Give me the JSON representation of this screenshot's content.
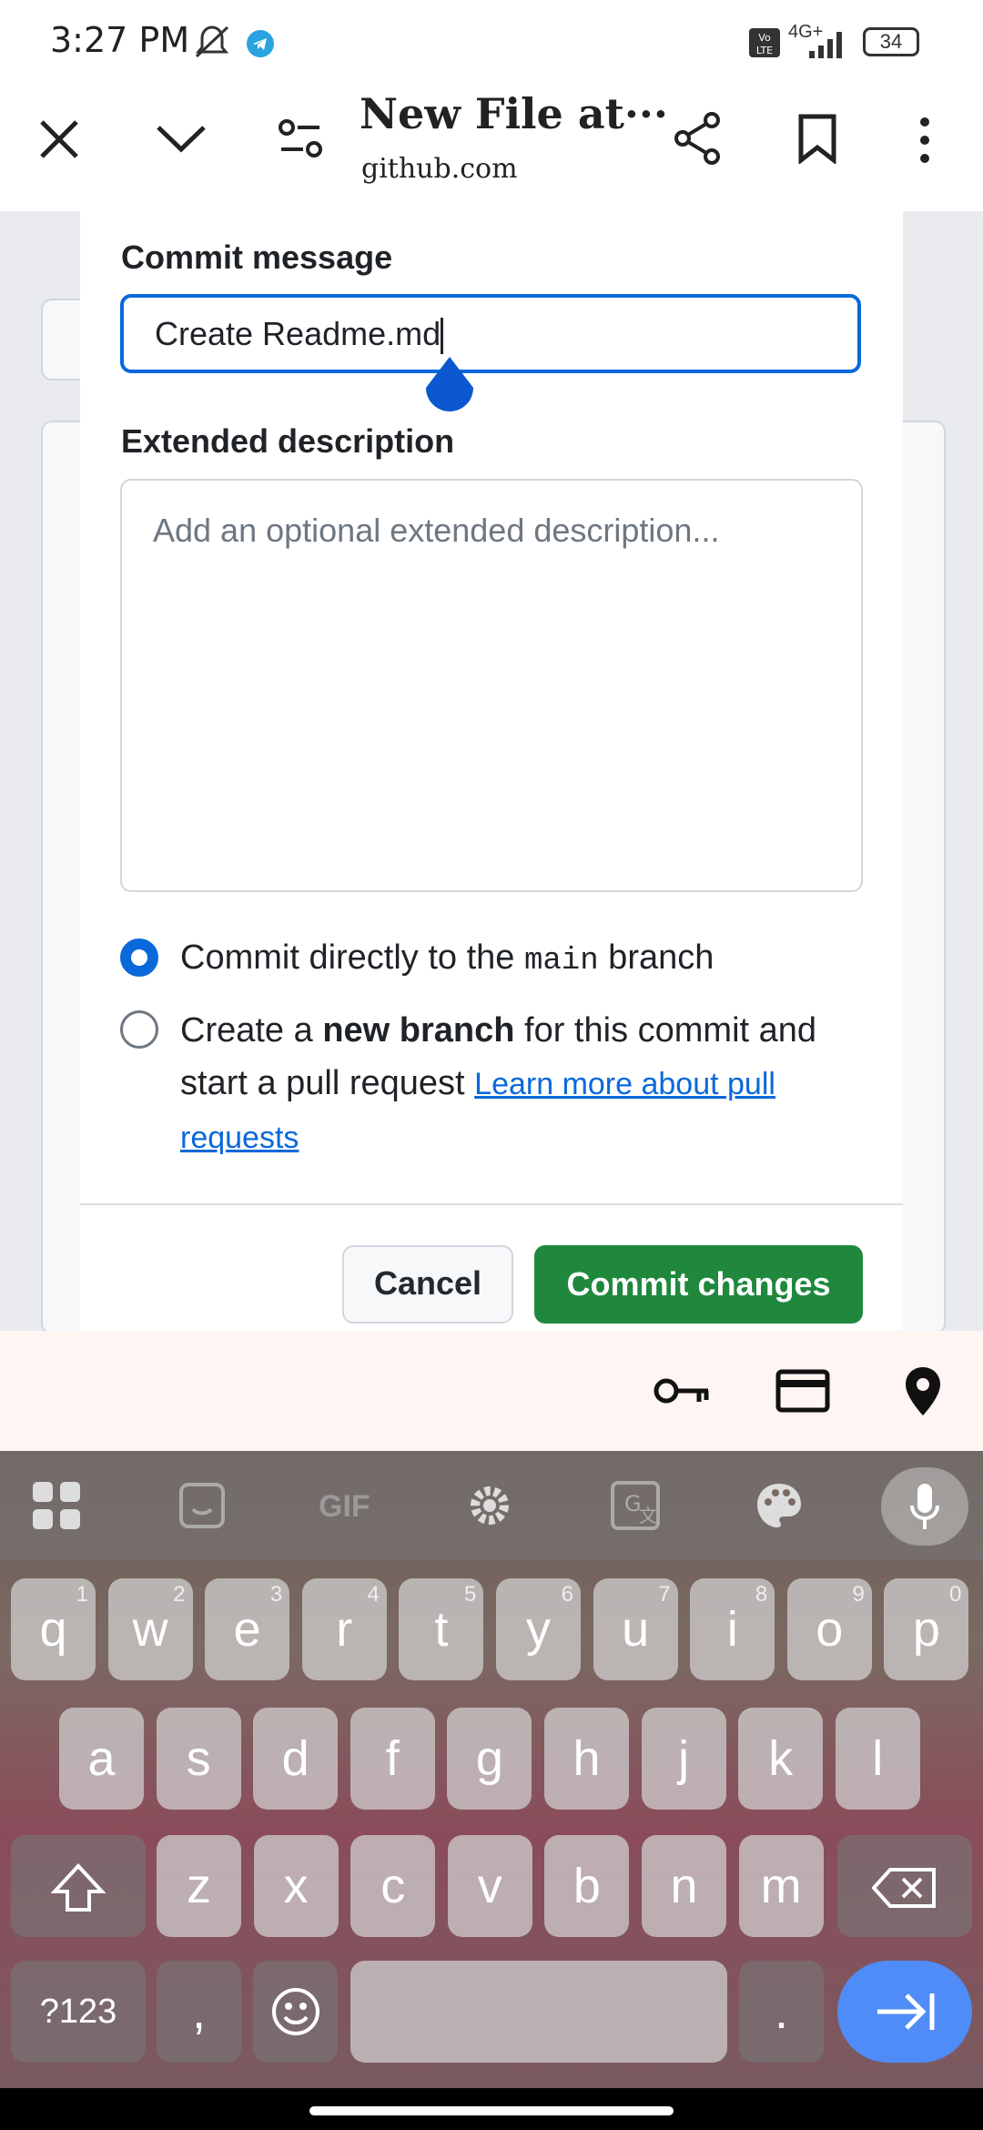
{
  "status_bar": {
    "time": "3:27 PM",
    "network": "4G+",
    "battery": "34"
  },
  "browser": {
    "title": "New File at···",
    "url": "github.com"
  },
  "modal": {
    "commit_label": "Commit message",
    "commit_value": "Create Readme.md",
    "desc_label": "Extended description",
    "desc_placeholder": "Add an optional extended description...",
    "option1_pre": "Commit directly to the ",
    "option1_code": "main",
    "option1_post": " branch",
    "option2_pre": "Create a ",
    "option2_bold": "new branch",
    "option2_post": " for this commit and start a pull request ",
    "option2_link": "Learn more about pull requests",
    "cancel": "Cancel",
    "commit_btn": "Commit changes",
    "colors": {
      "accent": "#0969da",
      "commit_green": "#1f883d"
    }
  },
  "keyboard": {
    "row1": [
      {
        "k": "q",
        "h": "1"
      },
      {
        "k": "w",
        "h": "2"
      },
      {
        "k": "e",
        "h": "3"
      },
      {
        "k": "r",
        "h": "4"
      },
      {
        "k": "t",
        "h": "5"
      },
      {
        "k": "y",
        "h": "6"
      },
      {
        "k": "u",
        "h": "7"
      },
      {
        "k": "i",
        "h": "8"
      },
      {
        "k": "o",
        "h": "9"
      },
      {
        "k": "p",
        "h": "0"
      }
    ],
    "row2": [
      "a",
      "s",
      "d",
      "f",
      "g",
      "h",
      "j",
      "k",
      "l"
    ],
    "row3": [
      "z",
      "x",
      "c",
      "v",
      "b",
      "n",
      "m"
    ],
    "symbols": "?123",
    "comma": ",",
    "period": ".",
    "top_icons": [
      "apps-icon",
      "sticker-icon",
      "gif",
      "settings-icon",
      "translate-icon",
      "palette-icon",
      "mic-icon"
    ],
    "gif_label": "GIF"
  }
}
